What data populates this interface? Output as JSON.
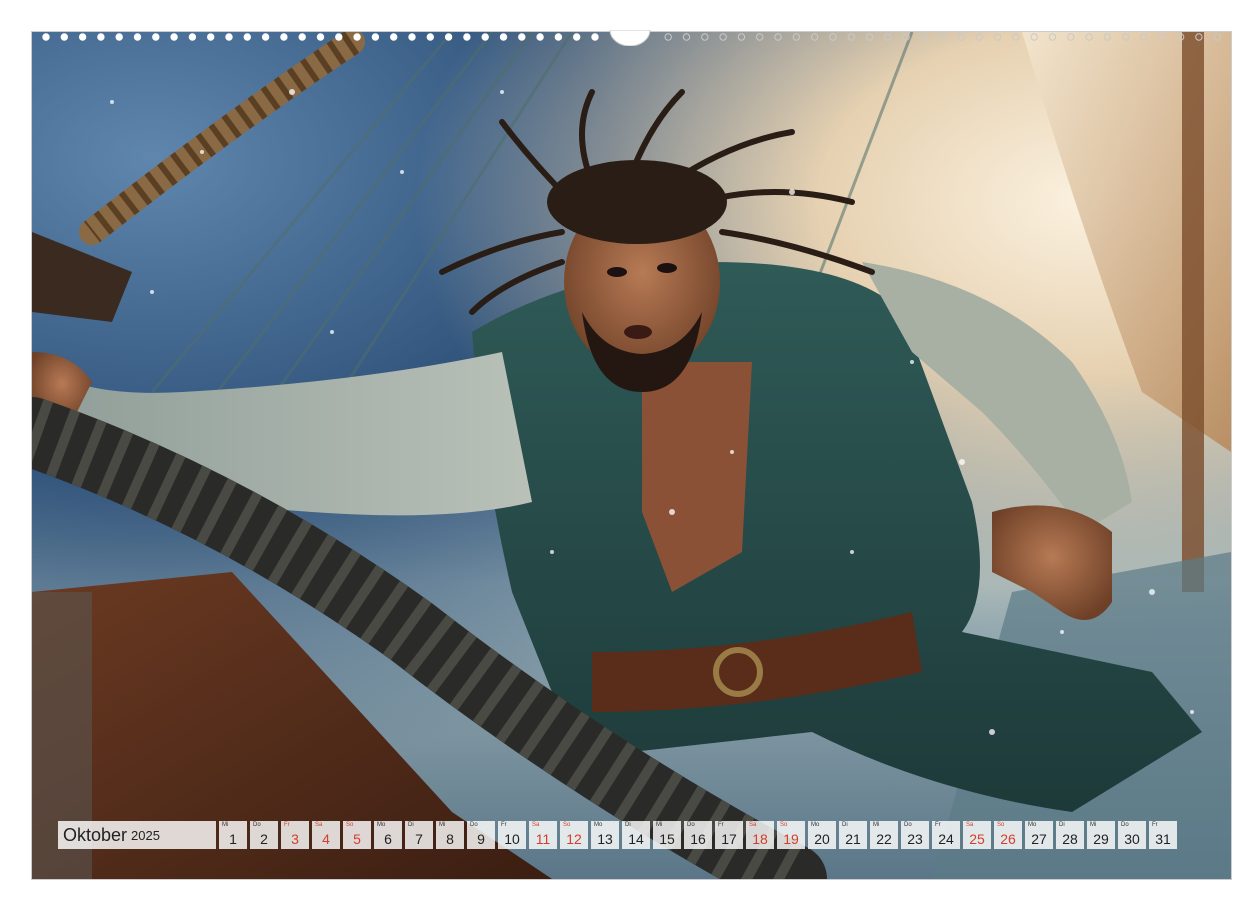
{
  "calendar": {
    "month": "Oktober",
    "year": "2025",
    "weekend_color": "#d0402a",
    "days": [
      {
        "dow": "Mi",
        "num": "1",
        "weekend": false
      },
      {
        "dow": "Do",
        "num": "2",
        "weekend": false
      },
      {
        "dow": "Fr",
        "num": "3",
        "weekend": true
      },
      {
        "dow": "Sa",
        "num": "4",
        "weekend": true
      },
      {
        "dow": "So",
        "num": "5",
        "weekend": true
      },
      {
        "dow": "Mo",
        "num": "6",
        "weekend": false
      },
      {
        "dow": "Di",
        "num": "7",
        "weekend": false
      },
      {
        "dow": "Mi",
        "num": "8",
        "weekend": false
      },
      {
        "dow": "Do",
        "num": "9",
        "weekend": false
      },
      {
        "dow": "Fr",
        "num": "10",
        "weekend": false
      },
      {
        "dow": "Sa",
        "num": "11",
        "weekend": true
      },
      {
        "dow": "So",
        "num": "12",
        "weekend": true
      },
      {
        "dow": "Mo",
        "num": "13",
        "weekend": false
      },
      {
        "dow": "Di",
        "num": "14",
        "weekend": false
      },
      {
        "dow": "Mi",
        "num": "15",
        "weekend": false
      },
      {
        "dow": "Do",
        "num": "16",
        "weekend": false
      },
      {
        "dow": "Fr",
        "num": "17",
        "weekend": false
      },
      {
        "dow": "Sa",
        "num": "18",
        "weekend": true
      },
      {
        "dow": "So",
        "num": "19",
        "weekend": true
      },
      {
        "dow": "Mo",
        "num": "20",
        "weekend": false
      },
      {
        "dow": "Di",
        "num": "21",
        "weekend": false
      },
      {
        "dow": "Mi",
        "num": "22",
        "weekend": false
      },
      {
        "dow": "Do",
        "num": "23",
        "weekend": false
      },
      {
        "dow": "Fr",
        "num": "24",
        "weekend": false
      },
      {
        "dow": "Sa",
        "num": "25",
        "weekend": true
      },
      {
        "dow": "So",
        "num": "26",
        "weekend": true
      },
      {
        "dow": "Mo",
        "num": "27",
        "weekend": false
      },
      {
        "dow": "Di",
        "num": "28",
        "weekend": false
      },
      {
        "dow": "Mi",
        "num": "29",
        "weekend": false
      },
      {
        "dow": "Do",
        "num": "30",
        "weekend": false
      },
      {
        "dow": "Fr",
        "num": "31",
        "weekend": false
      }
    ]
  },
  "photo": {
    "icon": "pirate-on-ship-photo"
  }
}
